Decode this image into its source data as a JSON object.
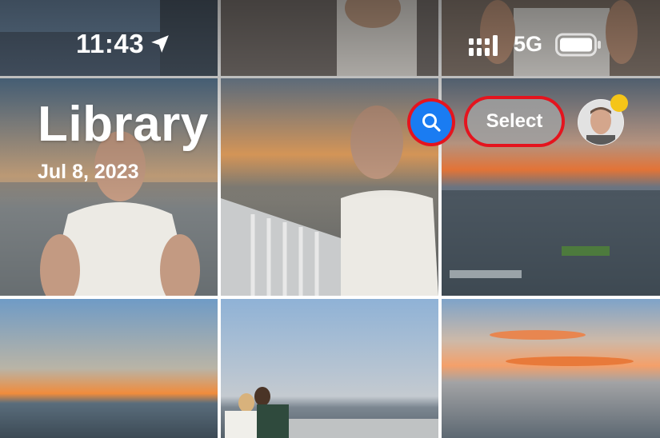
{
  "status_bar": {
    "time": "11:43",
    "network": "5G",
    "icons": [
      "location-arrow-icon",
      "signal-icon",
      "battery-icon"
    ]
  },
  "header": {
    "title": "Library",
    "date": "Jul 8, 2023",
    "select_label": "Select",
    "search_icon": "search-icon"
  },
  "colors": {
    "accent": "#1a7cf2",
    "highlight_outline": "#e5141e",
    "notification_dot": "#f5c518"
  },
  "photos": [
    {
      "desc": "man-sunset-skyline"
    },
    {
      "desc": "man-observation-deck"
    },
    {
      "desc": "sunset-city-view"
    },
    {
      "desc": "sunset-horizon"
    },
    {
      "desc": "couple-at-railing"
    },
    {
      "desc": "orange-clouds-city"
    }
  ]
}
